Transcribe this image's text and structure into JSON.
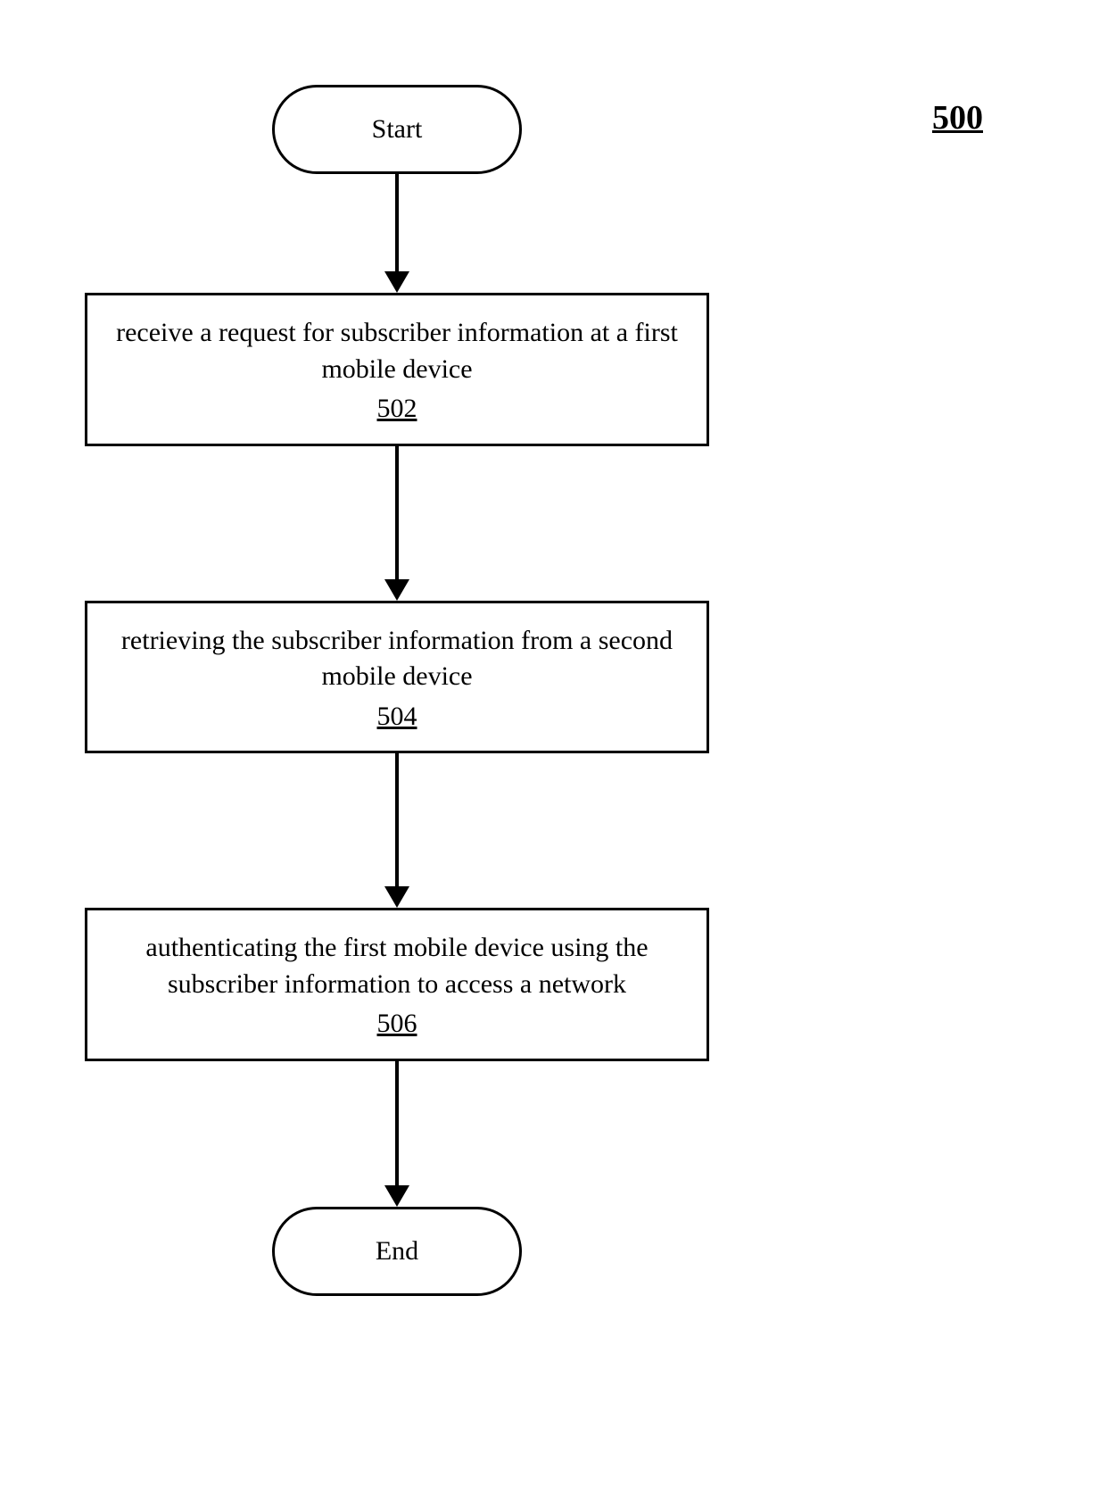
{
  "figure_number": "500",
  "start": {
    "label": "Start"
  },
  "step1": {
    "text": "receive a request for subscriber information at a first mobile device",
    "ref": "502"
  },
  "step2": {
    "text": "retrieving the subscriber information from a second mobile device",
    "ref": "504"
  },
  "step3": {
    "text": "authenticating the first mobile device using the subscriber information to access a network",
    "ref": "506"
  },
  "end": {
    "label": "End"
  }
}
